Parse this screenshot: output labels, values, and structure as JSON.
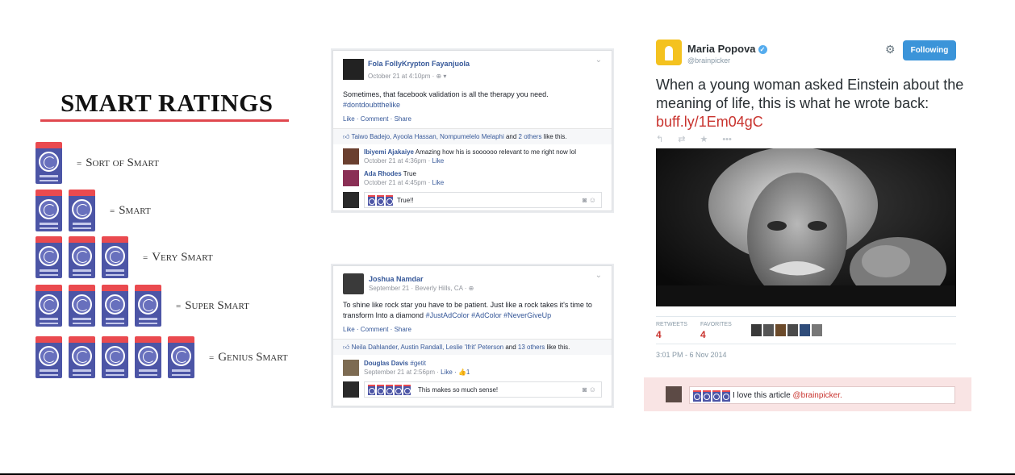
{
  "legend": {
    "title": "SMART RATINGS",
    "rows": [
      {
        "count": 1,
        "label": "Sort of Smart"
      },
      {
        "count": 2,
        "label": "Smart"
      },
      {
        "count": 3,
        "label": "Very Smart"
      },
      {
        "count": 4,
        "label": "Super Smart"
      },
      {
        "count": 5,
        "label": "Genius Smart"
      }
    ],
    "dash": "="
  },
  "fb_post_1": {
    "author": "Fola FollyKrypton Fayanjuola",
    "meta": "October 21 at 4:10pm · ⊕ ▾",
    "text": "Sometimes, that facebook validation is all the therapy you need.",
    "hashtag": "#dontdoubtthelike",
    "actions": "Like · Comment · Share",
    "likes_names": "Taiwo Badejo, Ayoola Hassan, Nompumelelo Melaphi",
    "likes_and": " and ",
    "likes_others": "2 others",
    "likes_suffix": " like this.",
    "comments": [
      {
        "name": "Ibiyemi Ajakaiye",
        "text": " Amazing how his is soooooo relevant to me right now lol",
        "time": "October 21 at 4:36pm · ",
        "like": "Like"
      },
      {
        "name": "Ada Rhodes",
        "text": " True",
        "time": "October 21 at 4:45pm · ",
        "like": "Like"
      }
    ],
    "reply": {
      "badge_count": 3,
      "text": "True!!"
    }
  },
  "fb_post_2": {
    "author": "Joshua Namdar",
    "meta": "September 21 · Beverly Hills, CA · ⊕",
    "text_line1": "To shine like rock star you have to be patient. Just like a rock takes it's time to",
    "text_line2_plain": "transform Into a diamond ",
    "text_line2_tags": "#JustAdColor #AdColor #NeverGiveUp",
    "actions": "Like · Comment · Share",
    "likes_names": "Neila Dahlander, Austin Randall, Leslie 'Ifrit' Peterson",
    "likes_and": " and ",
    "likes_others": "13 others",
    "likes_suffix": " like this.",
    "comment": {
      "name": "Douglas Davis",
      "tag": " #getit",
      "time": "September 21 at 2:56pm · ",
      "like": "Like",
      "like_count": " · 👍1"
    },
    "reply": {
      "badge_count": 5,
      "text": "This makes so much sense!"
    }
  },
  "tweet": {
    "name": "Maria Popova",
    "handle": "@brainpicker",
    "follow_label": "Following",
    "text": "When a young woman asked Einstein about the meaning of life, this is what he wrote back: ",
    "link": "buff.ly/1Em04gC",
    "retweets_label": "RETWEETS",
    "retweets": "4",
    "favorites_label": "FAVORITES",
    "favorites": "4",
    "timestamp": "3:01 PM - 6 Nov 2014",
    "reply": {
      "badge_count": 4,
      "text": "I love this article ",
      "mention": "@brainpicker."
    },
    "colors": {
      "accent": "#3b94d9",
      "link": "#c9342f",
      "reply_bg": "#f9e4e4"
    }
  },
  "icons": {
    "fb_chevron": "⌄",
    "camera": "📷",
    "smile": "☺",
    "gear": "⚙",
    "verified": "✓"
  },
  "colors": {
    "badge_blue": "#4c55a6",
    "badge_red": "#ea4a4f",
    "fb_link": "#365899"
  }
}
